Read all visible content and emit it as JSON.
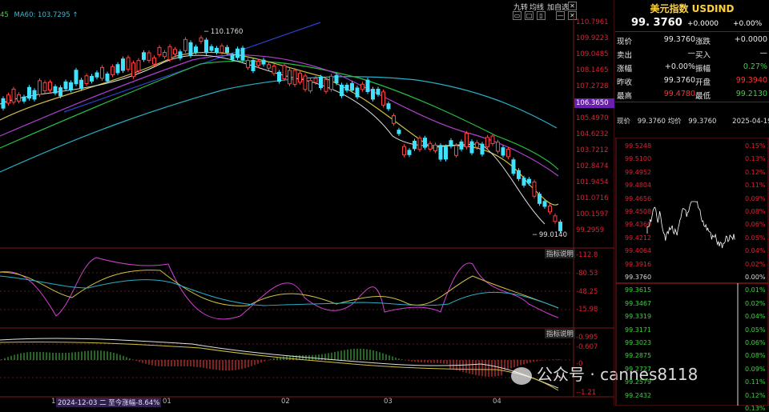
{
  "header": {
    "ma_label_prefix": "45",
    "ma60_label": "MA60: 103.7295",
    "ma60_arrow": "↑",
    "nav": [
      "九转",
      "均线",
      "加自选"
    ],
    "window_icons": [
      "restore-icon",
      "maximize-icon",
      "close-icon"
    ]
  },
  "main_chart": {
    "price_axis": [
      "110.7961",
      "109.9223",
      "109.0485",
      "108.1465",
      "107.2728",
      "106.3650",
      "105.4970",
      "104.6232",
      "103.7212",
      "102.8474",
      "101.9454",
      "101.0716",
      "100.1597",
      "99.2959"
    ],
    "current_price_box": "106.3650",
    "high_label": "110.1760",
    "low_label": "99.0140",
    "time_axis": [
      {
        "label": "1"
      },
      {
        "label": "2024-12-03 二 至今涨幅-8.64%"
      },
      {
        "label": "01"
      },
      {
        "label": "02"
      },
      {
        "label": "03"
      },
      {
        "label": "04"
      }
    ]
  },
  "indicator1": {
    "button": "指标说明",
    "axis": [
      "112.8",
      "80.53",
      "48.25",
      "15.98"
    ]
  },
  "indicator2": {
    "button": "指标说明",
    "axis": [
      "0.995",
      "0.607",
      "0",
      "-1.21"
    ]
  },
  "watermark": {
    "text": "公众号 · cannes8118"
  },
  "side": {
    "title": "美元指数 USDIND",
    "price": "99. 3760",
    "change": "+0.0000",
    "change_pct": "+0.00%",
    "rows": [
      {
        "l1": "现价",
        "v1": "99.3760",
        "l2": "涨跌",
        "v2": "+0.0000",
        "c1": "white",
        "c2": "white"
      },
      {
        "l1": "卖出",
        "v1": "—",
        "l2": "买入",
        "v2": "—",
        "c1": "white",
        "c2": "white"
      },
      {
        "l1": "涨幅",
        "v1": "+0.00%",
        "l2": "振幅",
        "v2": "0.27%",
        "c1": "white",
        "c2": "green"
      },
      {
        "l1": "昨收",
        "v1": "99.3760",
        "l2": "开盘",
        "v2": "99.3940",
        "c1": "white",
        "c2": "red"
      },
      {
        "l1": "最高",
        "v1": "99.4780",
        "l2": "最低",
        "v2": "99.2130",
        "c1": "red",
        "c2": "green"
      }
    ],
    "intraday_header": {
      "l1": "现价",
      "v1": "99.3760",
      "l2": "均价",
      "v2": "99.3760",
      "date": "2025-04-19"
    },
    "intraday_prices": [
      "99.5248",
      "99.5100",
      "99.4952",
      "99.4804",
      "99.4656",
      "99.4508",
      "99.4360",
      "99.4212",
      "99.4064",
      "99.3916",
      "99.3760",
      "99.3615",
      "99.3467",
      "99.3319",
      "99.3171",
      "99.3023",
      "99.2875",
      "99.2727",
      "99.2579",
      "99.2432"
    ],
    "intraday_pcts": [
      "0.15%",
      "0.13%",
      "0.12%",
      "0.11%",
      "0.09%",
      "0.08%",
      "0.06%",
      "0.05%",
      "0.04%",
      "0.02%",
      "0.00%",
      "0.01%",
      "0.02%",
      "0.04%",
      "0.05%",
      "0.06%",
      "0.08%",
      "0.09%",
      "0.11%",
      "0.12%",
      "0.13%"
    ]
  }
}
